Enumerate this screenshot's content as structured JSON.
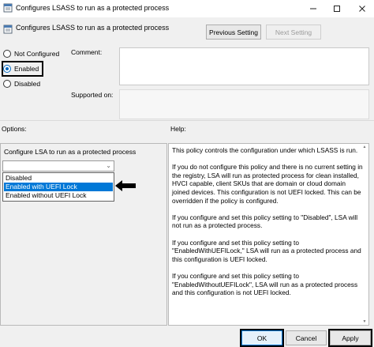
{
  "window": {
    "title": "Configures LSASS to run as a protected process",
    "icons": {
      "app": "policy-settings-icon",
      "minimize": "minimize-icon",
      "maximize": "maximize-icon",
      "close": "close-icon"
    }
  },
  "header": {
    "title": "Configures LSASS to run as a protected process",
    "icon": "policy-settings-icon",
    "prev_label": "Previous Setting",
    "next_label": "Next Setting"
  },
  "state": {
    "options": [
      {
        "label": "Not Configured",
        "checked": false
      },
      {
        "label": "Enabled",
        "checked": true
      },
      {
        "label": "Disabled",
        "checked": false
      }
    ]
  },
  "comment": {
    "label": "Comment:",
    "value": ""
  },
  "supported": {
    "label": "Supported on:",
    "value": ""
  },
  "options_section": {
    "label": "Options:",
    "caption": "Configure LSA to run as a protected process",
    "combo_value": "",
    "dropdown_items": [
      {
        "label": "Disabled",
        "selected": false
      },
      {
        "label": "Enabled with UEFI Lock",
        "selected": true
      },
      {
        "label": "Enabled without UEFI Lock",
        "selected": false
      }
    ],
    "pointer_icon": "left-arrow-icon"
  },
  "help_section": {
    "label": "Help:",
    "paragraphs": [
      "This policy controls the configuration under which LSASS is run.",
      "If you do not configure this policy and there is no current setting in the registry, LSA will run as protected process for clean installed, HVCI capable, client SKUs that are domain or cloud domain joined devices. This configuration is not UEFI locked. This can be overridden if the policy is configured.",
      "If you configure and set this policy setting to \"Disabled\", LSA will not run as a protected process.",
      "If you configure and set this policy setting to \"EnabledWithUEFILock,\" LSA will run as a protected process and this configuration is UEFI locked.",
      "If you configure and set this policy setting to \"EnabledWithoutUEFILock\", LSA will run as a protected process and this configuration is not UEFI locked."
    ]
  },
  "footer": {
    "ok_label": "OK",
    "cancel_label": "Cancel",
    "apply_label": "Apply"
  },
  "colors": {
    "accent": "#0078d7",
    "highlight_border": "#000000"
  }
}
